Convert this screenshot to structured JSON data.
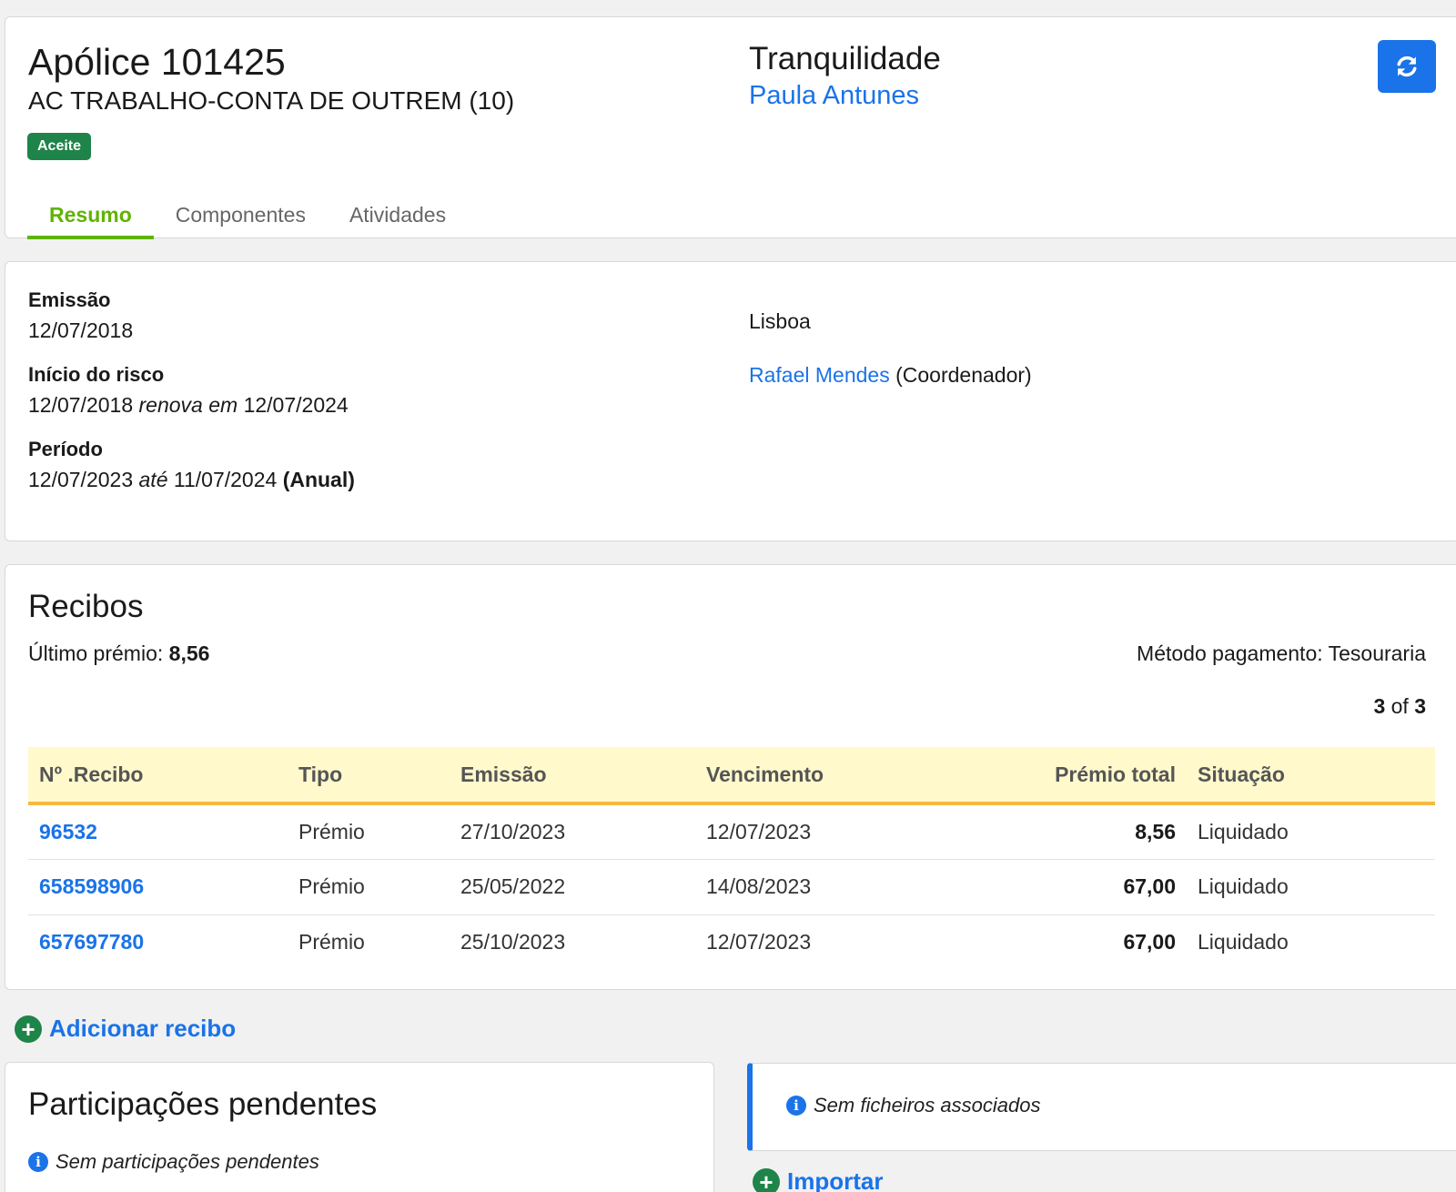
{
  "header": {
    "title": "Apólice 101425",
    "subtitle": "AC TRABALHO-CONTA DE OUTREM (10)",
    "status": "Aceite",
    "insurer": "Tranquilidade",
    "agent": "Paula Antunes",
    "tabs": [
      {
        "label": "Resumo",
        "active": true
      },
      {
        "label": "Componentes",
        "active": false
      },
      {
        "label": "Atividades",
        "active": false
      }
    ]
  },
  "details": {
    "issue_label": "Emissão",
    "issue_value": "12/07/2018",
    "risk_start_label": "Início do risco",
    "risk_start_date": "12/07/2018",
    "risk_renew_text": "renova em",
    "risk_renew_date": "12/07/2024",
    "period_label": "Período",
    "period_start": "12/07/2023",
    "period_until_text": "até",
    "period_end": "11/07/2024",
    "period_type": "(Anual)",
    "location": "Lisboa",
    "coordinator_name": "Rafael Mendes",
    "coordinator_role": "(Coordenador)"
  },
  "receipts": {
    "title": "Recibos",
    "last_premium_label": "Último prémio:",
    "last_premium_value": "8,56",
    "payment_method": "Método pagamento: Tesouraria",
    "pager_current": "3",
    "pager_of": "of",
    "pager_total": "3",
    "columns": [
      "Nº .Recibo",
      "Tipo",
      "Emissão",
      "Vencimento",
      "Prémio total",
      "Situação"
    ],
    "rows": [
      {
        "number": "96532",
        "type": "Prémio",
        "issued": "27/10/2023",
        "due": "12/07/2023",
        "total": "8,56",
        "status": "Liquidado"
      },
      {
        "number": "658598906",
        "type": "Prémio",
        "issued": "25/05/2022",
        "due": "14/08/2023",
        "total": "67,00",
        "status": "Liquidado"
      },
      {
        "number": "657697780",
        "type": "Prémio",
        "issued": "25/10/2023",
        "due": "12/07/2023",
        "total": "67,00",
        "status": "Liquidado"
      }
    ],
    "add_label": "Adicionar recibo"
  },
  "pending": {
    "title": "Participações pendentes",
    "empty_text": "Sem participações pendentes"
  },
  "files": {
    "empty_text": "Sem ficheiros associados",
    "import_label": "Importar"
  },
  "colors": {
    "accent_blue": "#1a73e8",
    "active_tab_green": "#5fb400",
    "badge_green": "#1e8449",
    "table_header_bg": "#fff9cc",
    "table_header_border": "#f5b942"
  }
}
